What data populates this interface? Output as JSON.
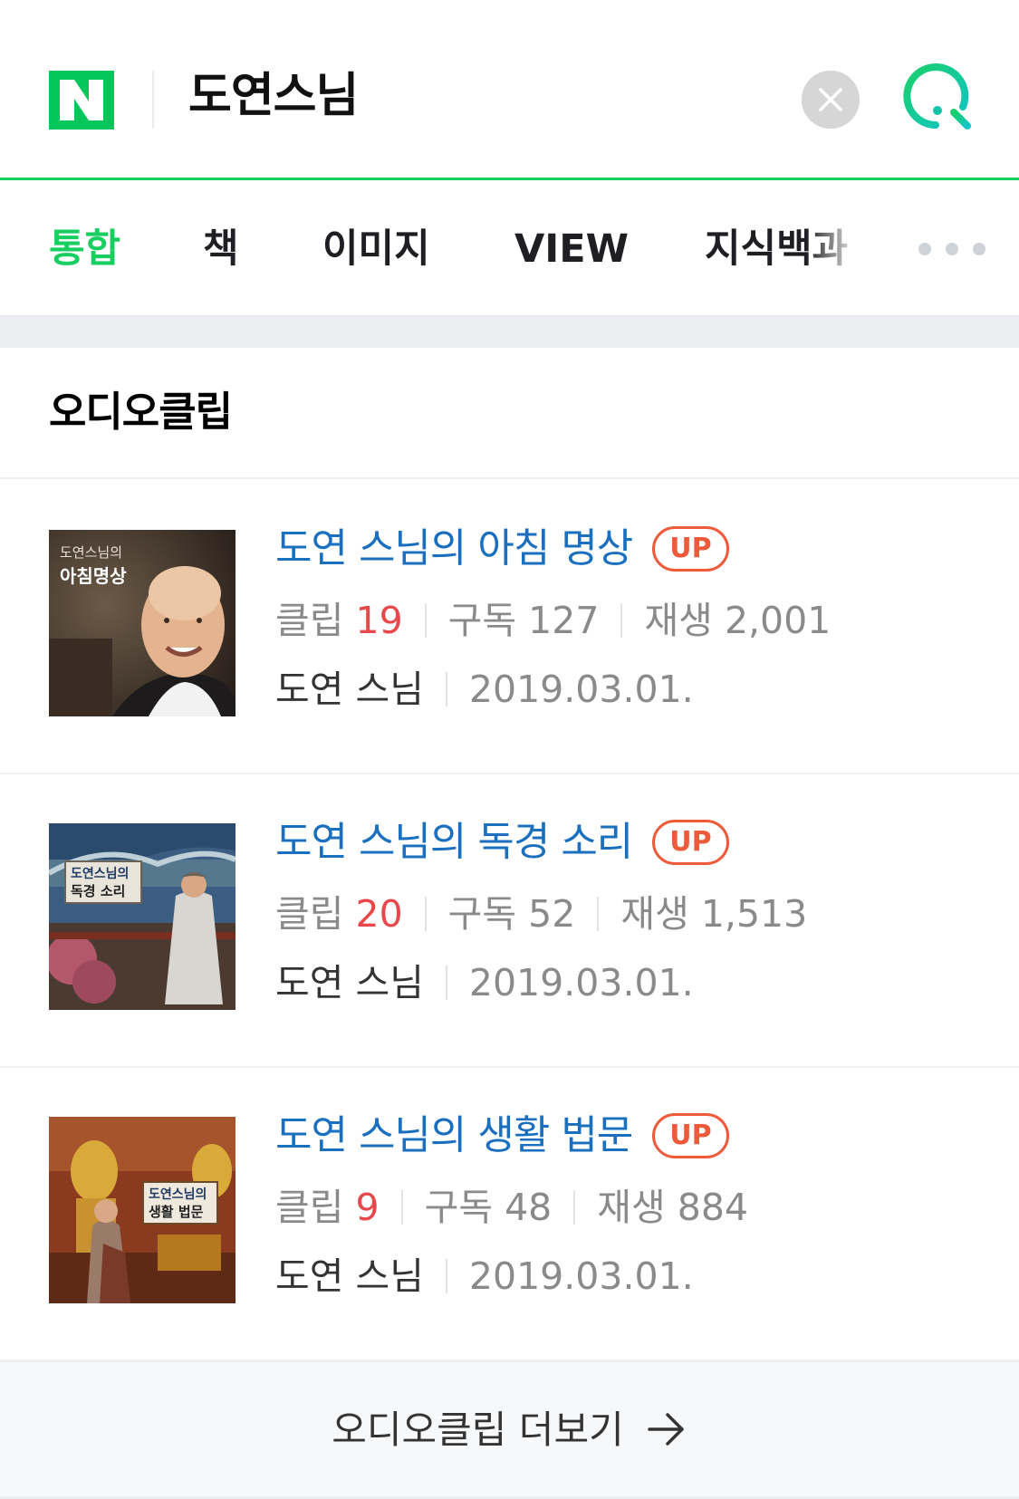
{
  "header": {
    "logo_letter": "N",
    "query": "도연스님",
    "clear_icon": "close-icon",
    "search_icon": "search-icon",
    "accent_color": "#19ce60"
  },
  "tabs": [
    {
      "label": "통합",
      "active": true
    },
    {
      "label": "책",
      "active": false
    },
    {
      "label": "이미지",
      "active": false
    },
    {
      "label": "VIEW",
      "active": false
    },
    {
      "label": "지식백과",
      "active": false
    }
  ],
  "more_tabs_icon": "more-horizontal-icon",
  "section": {
    "title": "오디오클립",
    "items": [
      {
        "title": "도연 스님의 아침 명상",
        "badge": "UP",
        "clip_label": "클립",
        "clip_count": "19",
        "subscribe_label": "구독",
        "subscribe_count": "127",
        "play_label": "재생",
        "play_count": "2,001",
        "author": "도연 스님",
        "date": "2019.03.01.",
        "thumb_text_line1": "도연스님의",
        "thumb_text_line2": "아침명상"
      },
      {
        "title": "도연 스님의 독경 소리",
        "badge": "UP",
        "clip_label": "클립",
        "clip_count": "20",
        "subscribe_label": "구독",
        "subscribe_count": "52",
        "play_label": "재생",
        "play_count": "1,513",
        "author": "도연 스님",
        "date": "2019.03.01.",
        "thumb_text_line1": "도연스님의",
        "thumb_text_line2": "독경 소리"
      },
      {
        "title": "도연 스님의 생활 법문",
        "badge": "UP",
        "clip_label": "클립",
        "clip_count": "9",
        "subscribe_label": "구독",
        "subscribe_count": "48",
        "play_label": "재생",
        "play_count": "884",
        "author": "도연 스님",
        "date": "2019.03.01.",
        "thumb_text_line1": "도연스님의",
        "thumb_text_line2": "생활 법문"
      }
    ],
    "more_label": "오디오클립 더보기",
    "more_icon": "arrow-right-icon"
  }
}
